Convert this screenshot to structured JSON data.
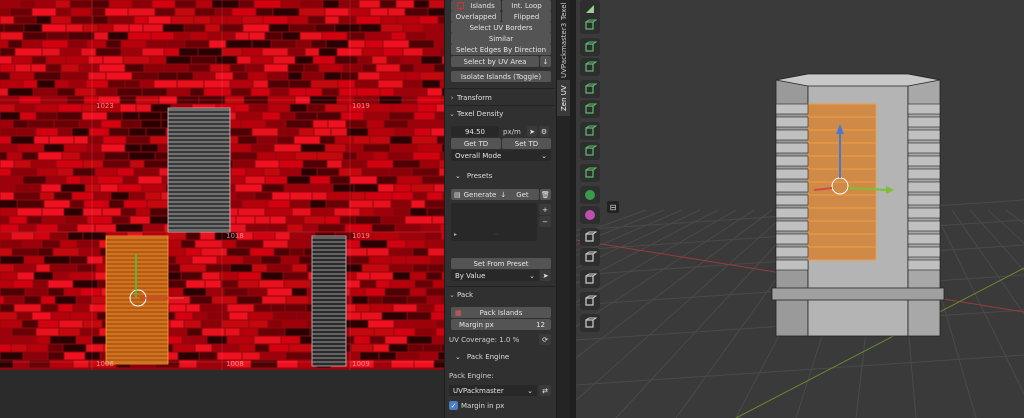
{
  "uv_editor": {
    "tile_labels": [
      "1023",
      "1019",
      "1018",
      "1019",
      "1009",
      "1006",
      "1008"
    ]
  },
  "panel": {
    "islands_label": "Islands",
    "int_loop_label": "Int. Loop",
    "overlapped_label": "Overlapped",
    "flipped_label": "Flipped",
    "select_uv_borders_label": "Select UV Borders",
    "similar_label": "Similar",
    "select_edges_label": "Select Edges By Direction",
    "select_by_uv_area_label": "Select by UV Area",
    "isolate_label": "Isolate Islands (Toggle)",
    "transform_header": "Transform",
    "texel_header": "Texel Density",
    "td_value": "94.50",
    "td_unit": "px/m",
    "get_td_label": "Get TD",
    "set_td_label": "Set TD",
    "mode_label": "Overall Mode",
    "presets_header": "Presets",
    "generate_label": "Generate",
    "get_label": "Get",
    "set_from_preset_label": "Set From Preset",
    "by_value_label": "By Value",
    "pack_header": "Pack",
    "pack_islands_label": "Pack Islands",
    "margin_label": "Margin px",
    "margin_value": "12",
    "uv_coverage_label": "UV Coverage: 1.0 %",
    "pack_engine_header": "Pack Engine",
    "pack_engine_label": "Pack Engine:",
    "pack_engine_value": "UVPackmaster",
    "margin_in_px_label": "Margin in px"
  },
  "side_tabs": [
    "Texel",
    "UVPackmaster3",
    "Zen UV"
  ],
  "colors": {
    "uv_background": "#8a0a10",
    "selection": "#e8862a",
    "panel_bg": "#303030",
    "viewport_bg": "#3a3a3a"
  },
  "tools": [
    "select-box-icon",
    "cursor-icon",
    "add-cube-icon",
    "extrude-icon",
    "inset-icon",
    "bevel-icon",
    "loop-cut-icon",
    "knife-icon",
    "poly-build-icon",
    "spin-icon",
    "smooth-icon",
    "edge-slide-icon",
    "shrink-icon",
    "shear-icon",
    "rip-icon",
    "uv-square-icon"
  ]
}
